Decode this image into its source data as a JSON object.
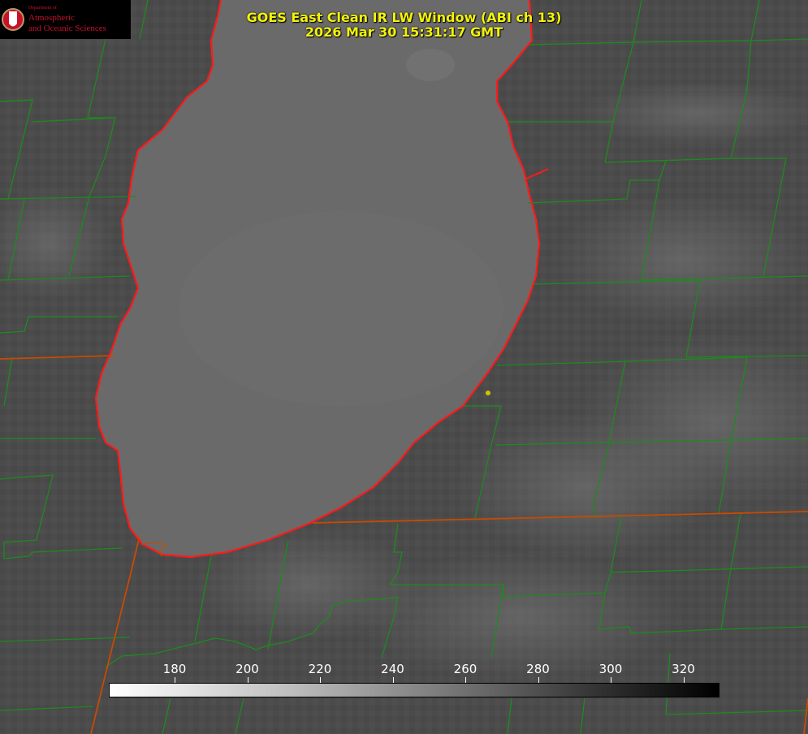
{
  "title": {
    "line1": "GOES East Clean IR LW Window (ABI ch 13)",
    "line2": "2026 Mar 30 15:31:17 GMT"
  },
  "logo": {
    "dept": "Department of",
    "line1": "Atmospheric",
    "line2": "and Oceanic Sciences",
    "seal_letter": "W"
  },
  "colorbar": {
    "ticks": [
      {
        "value": 180,
        "label": "180"
      },
      {
        "value": 200,
        "label": "200"
      },
      {
        "value": 220,
        "label": "220"
      },
      {
        "value": 240,
        "label": "240"
      },
      {
        "value": 260,
        "label": "260"
      },
      {
        "value": 280,
        "label": "280"
      },
      {
        "value": 300,
        "label": "300"
      },
      {
        "value": 320,
        "label": "320"
      }
    ]
  },
  "colors": {
    "title_text": "#f2f20a",
    "county_lines": "#1e8a1e",
    "state_lines": "#c84a00",
    "coastline": "#ff1a1a",
    "marker": "#d4c400"
  }
}
